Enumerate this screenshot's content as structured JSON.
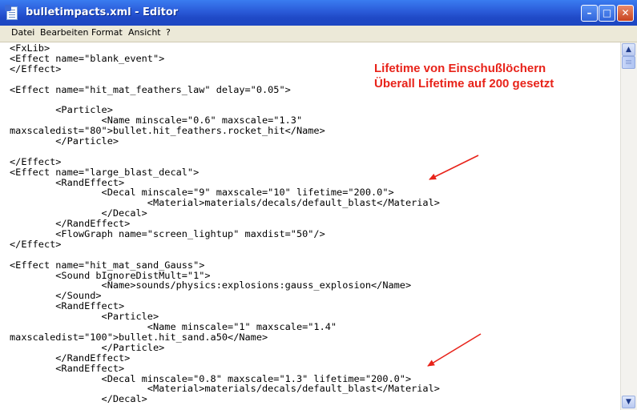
{
  "window": {
    "title": "bulletimpacts.xml - Editor",
    "minimize_glyph": "–",
    "maximize_glyph": "□",
    "close_glyph": "✕"
  },
  "menu": [
    "Datei",
    "Bearbeiten",
    "Format",
    "Ansicht",
    "?"
  ],
  "annotation": {
    "line1": "Lifetime von Einschußlöchern",
    "line2": "Überall Lifetime auf 200 gesetzt"
  },
  "code_lines": [
    "<FxLib>",
    "<Effect name=\"blank_event\">",
    "</Effect>",
    "",
    "<Effect name=\"hit_mat_feathers_law\" delay=\"0.05\">",
    "",
    "        <Particle>",
    "                <Name minscale=\"0.6\" maxscale=\"1.3\"",
    "maxscaledist=\"80\">bullet.hit_feathers.rocket_hit</Name>",
    "        </Particle>",
    "",
    "</Effect>",
    "<Effect name=\"large_blast_decal\">",
    "        <RandEffect>",
    "                <Decal minscale=\"9\" maxscale=\"10\" lifetime=\"200.0\">",
    "                        <Material>materials/decals/default_blast</Material>",
    "                </Decal>",
    "        </RandEffect>",
    "        <FlowGraph name=\"screen_lightup\" maxdist=\"50\"/>",
    "</Effect>",
    "",
    "<Effect name=\"hit_mat_sand_Gauss\">",
    "        <Sound bIgnoreDistMult=\"1\">",
    "                <Name>sounds/physics:explosions:gauss_explosion</Name>",
    "        </Sound>",
    "        <RandEffect>",
    "                <Particle>",
    "                        <Name minscale=\"1\" maxscale=\"1.4\"",
    "maxscaledist=\"100\">bullet.hit_sand.a50</Name>",
    "                </Particle>",
    "        </RandEffect>",
    "        <RandEffect>",
    "                <Decal minscale=\"0.8\" maxscale=\"1.3\" lifetime=\"200.0\">",
    "                        <Material>materials/decals/default_blast</Material>",
    "                </Decal>"
  ],
  "colors": {
    "annotation": "#e8231a",
    "titlebar": "#2a5ad8",
    "menubar": "#ece9d8"
  }
}
